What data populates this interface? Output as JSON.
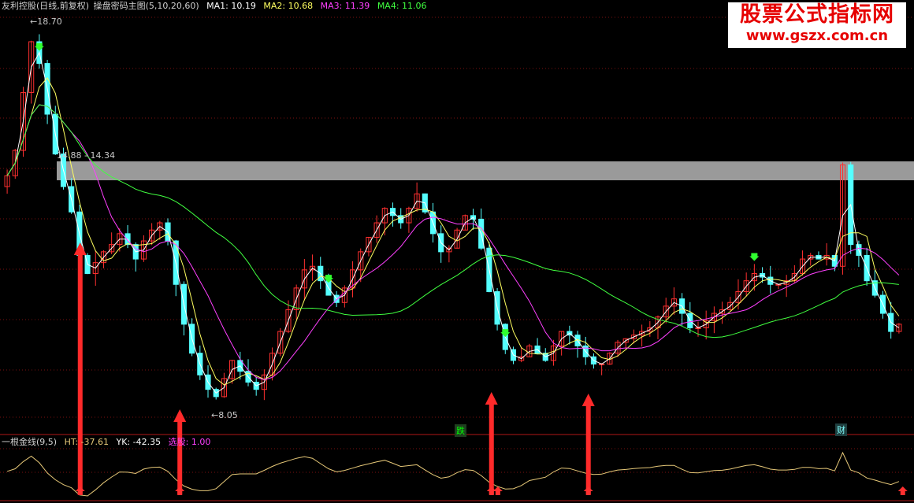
{
  "header": {
    "title": "友利控股(日线,前复权)",
    "indicator": "操盘密码主图(5,10,20,60)",
    "ma1": "MA1: 10.19",
    "ma2": "MA2: 10.68",
    "ma3": "MA3: 11.39",
    "ma4": "MA4: 11.06"
  },
  "sub_header": {
    "name": "一根金线(9,5)",
    "ht": "HT: -37.61",
    "yk": "YK: -42.35",
    "xg": "选股: 1.00"
  },
  "labels": {
    "high": "←18.70",
    "low": "←8.05",
    "band": "14.88 - 14.34"
  },
  "tags": {
    "die": "跌",
    "cai": "财"
  },
  "watermark": {
    "name": "股票公式指标网",
    "url": "www.gszx.com.cn"
  },
  "colors": {
    "up": "#ff3030",
    "down": "#54ffff",
    "ma1": "#ffffff",
    "ma2": "#ffff60",
    "ma3": "#ff40ff",
    "ma4": "#40ff40",
    "grid": "#7a1010",
    "band": "#9a9a9a",
    "arrow": "#ff2a2a",
    "sub_line": "#e6c878"
  },
  "chart_data": {
    "type": "candlestick",
    "price_range": [
      8.05,
      18.7
    ],
    "band_range": [
      14.34,
      14.88
    ],
    "close_path": [
      14.5,
      15.2,
      16.8,
      18.2,
      17.6,
      16.2,
      15.1,
      14.2,
      13.5,
      12.3,
      11.8,
      12.1,
      12.4,
      12.6,
      12.9,
      12.6,
      12.2,
      12.7,
      13.0,
      13.2,
      12.7,
      11.5,
      10.4,
      9.6,
      9.0,
      8.6,
      8.4,
      8.9,
      9.4,
      9.1,
      8.8,
      8.6,
      9.0,
      9.6,
      10.2,
      10.8,
      11.4,
      11.9,
      12.0,
      11.6,
      11.2,
      11.0,
      11.4,
      11.9,
      12.4,
      12.8,
      13.2,
      13.6,
      13.4,
      13.2,
      13.6,
      14.0,
      13.5,
      12.9,
      12.4,
      12.5,
      13.0,
      13.4,
      13.3,
      12.5,
      11.3,
      10.4,
      9.7,
      9.4,
      9.5,
      9.8,
      9.6,
      9.4,
      9.8,
      10.2,
      10.1,
      9.8,
      9.5,
      9.3,
      9.3,
      9.6,
      9.9,
      10.0,
      10.1,
      10.2,
      10.3,
      10.6,
      10.9,
      11.1,
      10.7,
      10.3,
      10.3,
      10.5,
      10.7,
      10.8,
      11.0,
      11.3,
      11.6,
      11.8,
      11.7,
      11.5,
      11.5,
      11.6,
      11.8,
      12.2,
      12.3,
      12.2,
      12.3,
      12.0,
      14.8,
      12.6,
      12.3,
      11.6,
      11.2,
      10.7,
      10.2,
      10.4
    ],
    "ma_series": [
      {
        "name": "MA1",
        "value": 10.19
      },
      {
        "name": "MA2",
        "value": 10.68
      },
      {
        "name": "MA3",
        "value": 11.39
      },
      {
        "name": "MA4",
        "value": 11.06
      }
    ],
    "buy_arrow_x_fraction": [
      0.086,
      0.195,
      0.536,
      0.642
    ]
  }
}
